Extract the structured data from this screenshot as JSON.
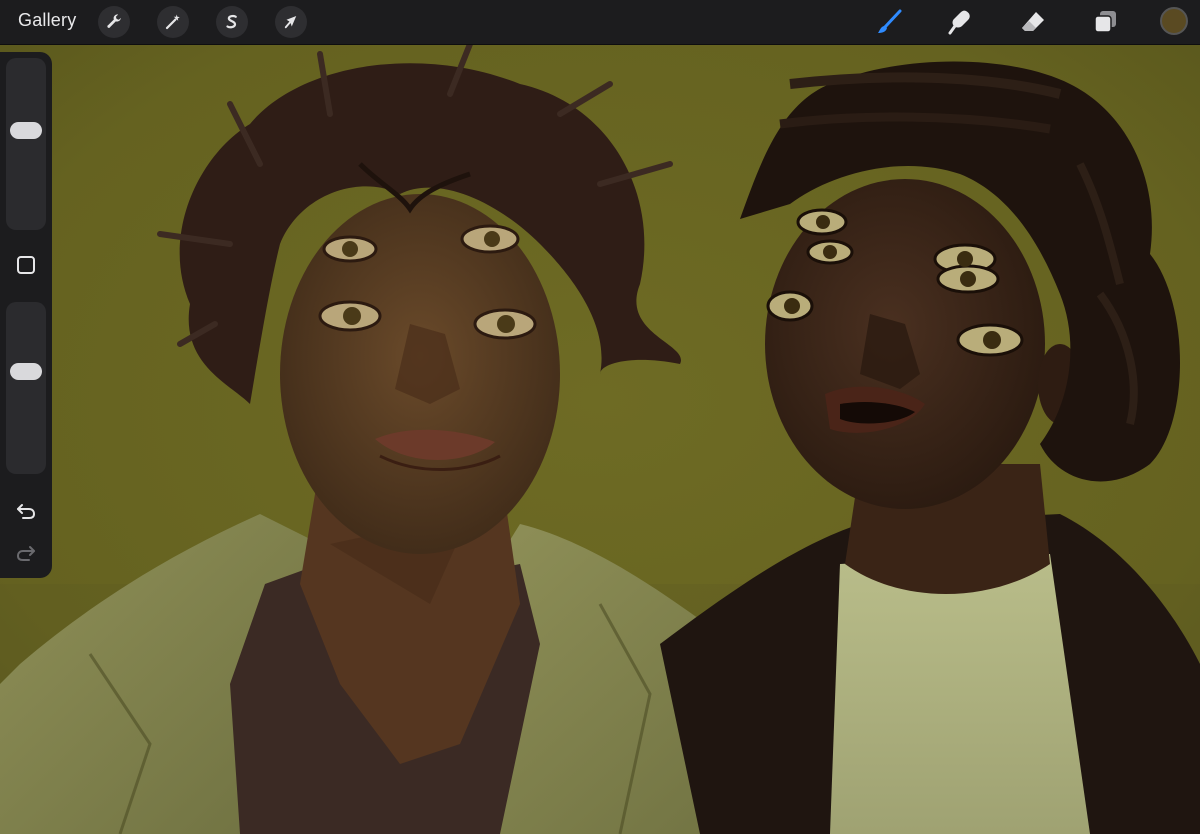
{
  "topbar": {
    "gallery_label": "Gallery",
    "left_tools": [
      {
        "name": "actions",
        "icon": "wrench-icon"
      },
      {
        "name": "adjustments",
        "icon": "magic-wand-icon"
      },
      {
        "name": "selection",
        "icon": "selection-s-icon"
      },
      {
        "name": "transform",
        "icon": "arrow-cursor-icon"
      }
    ],
    "right_tools": [
      {
        "name": "brush",
        "icon": "brush-icon",
        "active": true
      },
      {
        "name": "smudge",
        "icon": "smudge-finger-icon",
        "active": false
      },
      {
        "name": "eraser",
        "icon": "eraser-icon",
        "active": false
      },
      {
        "name": "layers",
        "icon": "layers-icon",
        "active": false
      }
    ],
    "current_color": "#5a4a22"
  },
  "sidebar": {
    "brush_size_level": 0.59,
    "opacity_level": 0.61,
    "modify_button_icon": "square-icon",
    "undo_icon": "undo-arrow-icon",
    "redo_icon": "redo-arrow-icon"
  },
  "colors": {
    "accent": "#2f8bff",
    "background_canvas": "#6c6a26",
    "ui_bar": "#1c1c1e"
  }
}
